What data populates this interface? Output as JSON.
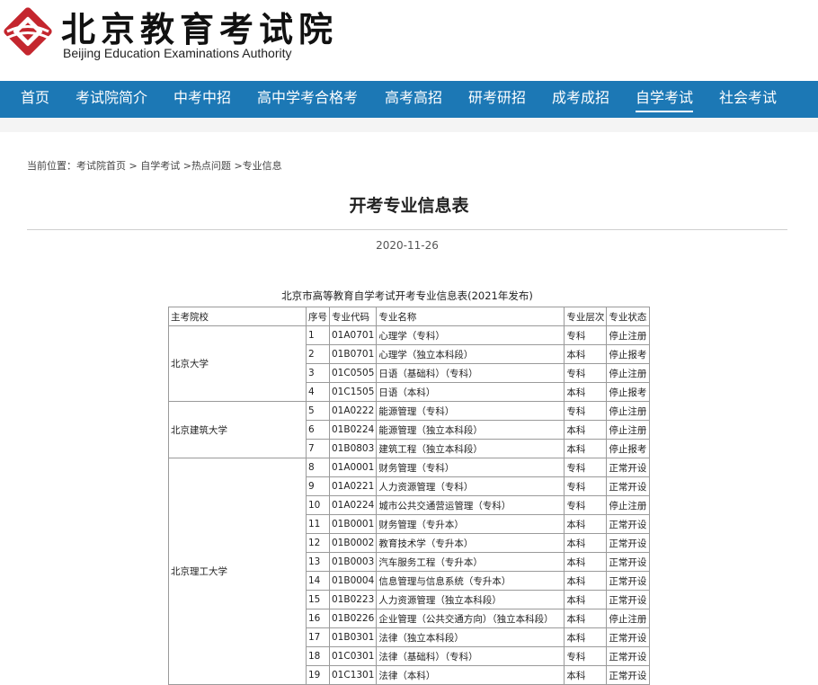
{
  "header": {
    "logo_cn": "北京教育考试院",
    "logo_en": "Beijing Education Examinations Authority",
    "brand_color": "#c4262e"
  },
  "nav": {
    "color": "#1c78b5",
    "items": [
      {
        "label": "首页"
      },
      {
        "label": "考试院简介"
      },
      {
        "label": "中考中招"
      },
      {
        "label": "高中学考合格考"
      },
      {
        "label": "高考高招"
      },
      {
        "label": "研考研招"
      },
      {
        "label": "成考成招"
      },
      {
        "label": "自学考试",
        "active": true
      },
      {
        "label": "社会考试"
      }
    ]
  },
  "breadcrumb": {
    "prefix": "当前位置：",
    "items": [
      "考试院首页",
      "自学考试",
      "热点问题",
      "专业信息"
    ],
    "separator": ">"
  },
  "article": {
    "title": "开考专业信息表",
    "date": "2020-11-26"
  },
  "table": {
    "caption": "北京市高等教育自学考试开考专业信息表(2021年发布)",
    "headers": [
      "主考院校",
      "序号",
      "专业代码",
      "专业名称",
      "专业层次",
      "专业状态"
    ],
    "groups": [
      {
        "school": "北京大学",
        "rows": [
          [
            "1",
            "01A0701",
            "心理学（专科）",
            "专科",
            "停止注册"
          ],
          [
            "2",
            "01B0701",
            "心理学（独立本科段）",
            "本科",
            "停止报考"
          ],
          [
            "3",
            "01C0505",
            "日语（基础科）（专科）",
            "专科",
            "停止注册"
          ],
          [
            "4",
            "01C1505",
            "日语（本科）",
            "本科",
            "停止报考"
          ]
        ]
      },
      {
        "school": "北京建筑大学",
        "rows": [
          [
            "5",
            "01A0222",
            "能源管理（专科）",
            "专科",
            "停止注册"
          ],
          [
            "6",
            "01B0224",
            "能源管理（独立本科段）",
            "本科",
            "停止注册"
          ],
          [
            "7",
            "01B0803",
            "建筑工程（独立本科段）",
            "本科",
            "停止报考"
          ]
        ]
      },
      {
        "school": "北京理工大学",
        "rows": [
          [
            "8",
            "01A0001",
            "财务管理（专科）",
            "专科",
            "正常开设"
          ],
          [
            "9",
            "01A0221",
            "人力资源管理（专科）",
            "专科",
            "正常开设"
          ],
          [
            "10",
            "01A0224",
            "城市公共交通营运管理（专科）",
            "专科",
            "停止注册"
          ],
          [
            "11",
            "01B0001",
            "财务管理（专升本）",
            "本科",
            "正常开设"
          ],
          [
            "12",
            "01B0002",
            "教育技术学（专升本）",
            "本科",
            "正常开设"
          ],
          [
            "13",
            "01B0003",
            "汽车服务工程（专升本）",
            "本科",
            "正常开设"
          ],
          [
            "14",
            "01B0004",
            "信息管理与信息系统（专升本）",
            "本科",
            "正常开设"
          ],
          [
            "15",
            "01B0223",
            "人力资源管理（独立本科段）",
            "本科",
            "正常开设"
          ],
          [
            "16",
            "01B0226",
            "企业管理（公共交通方向）（独立本科段）",
            "本科",
            "停止注册"
          ],
          [
            "17",
            "01B0301",
            "法律（独立本科段）",
            "本科",
            "正常开设"
          ],
          [
            "18",
            "01C0301",
            "法律（基础科）（专科）",
            "专科",
            "正常开设"
          ],
          [
            "19",
            "01C1301",
            "法律（本科）",
            "本科",
            "正常开设"
          ]
        ]
      }
    ]
  }
}
